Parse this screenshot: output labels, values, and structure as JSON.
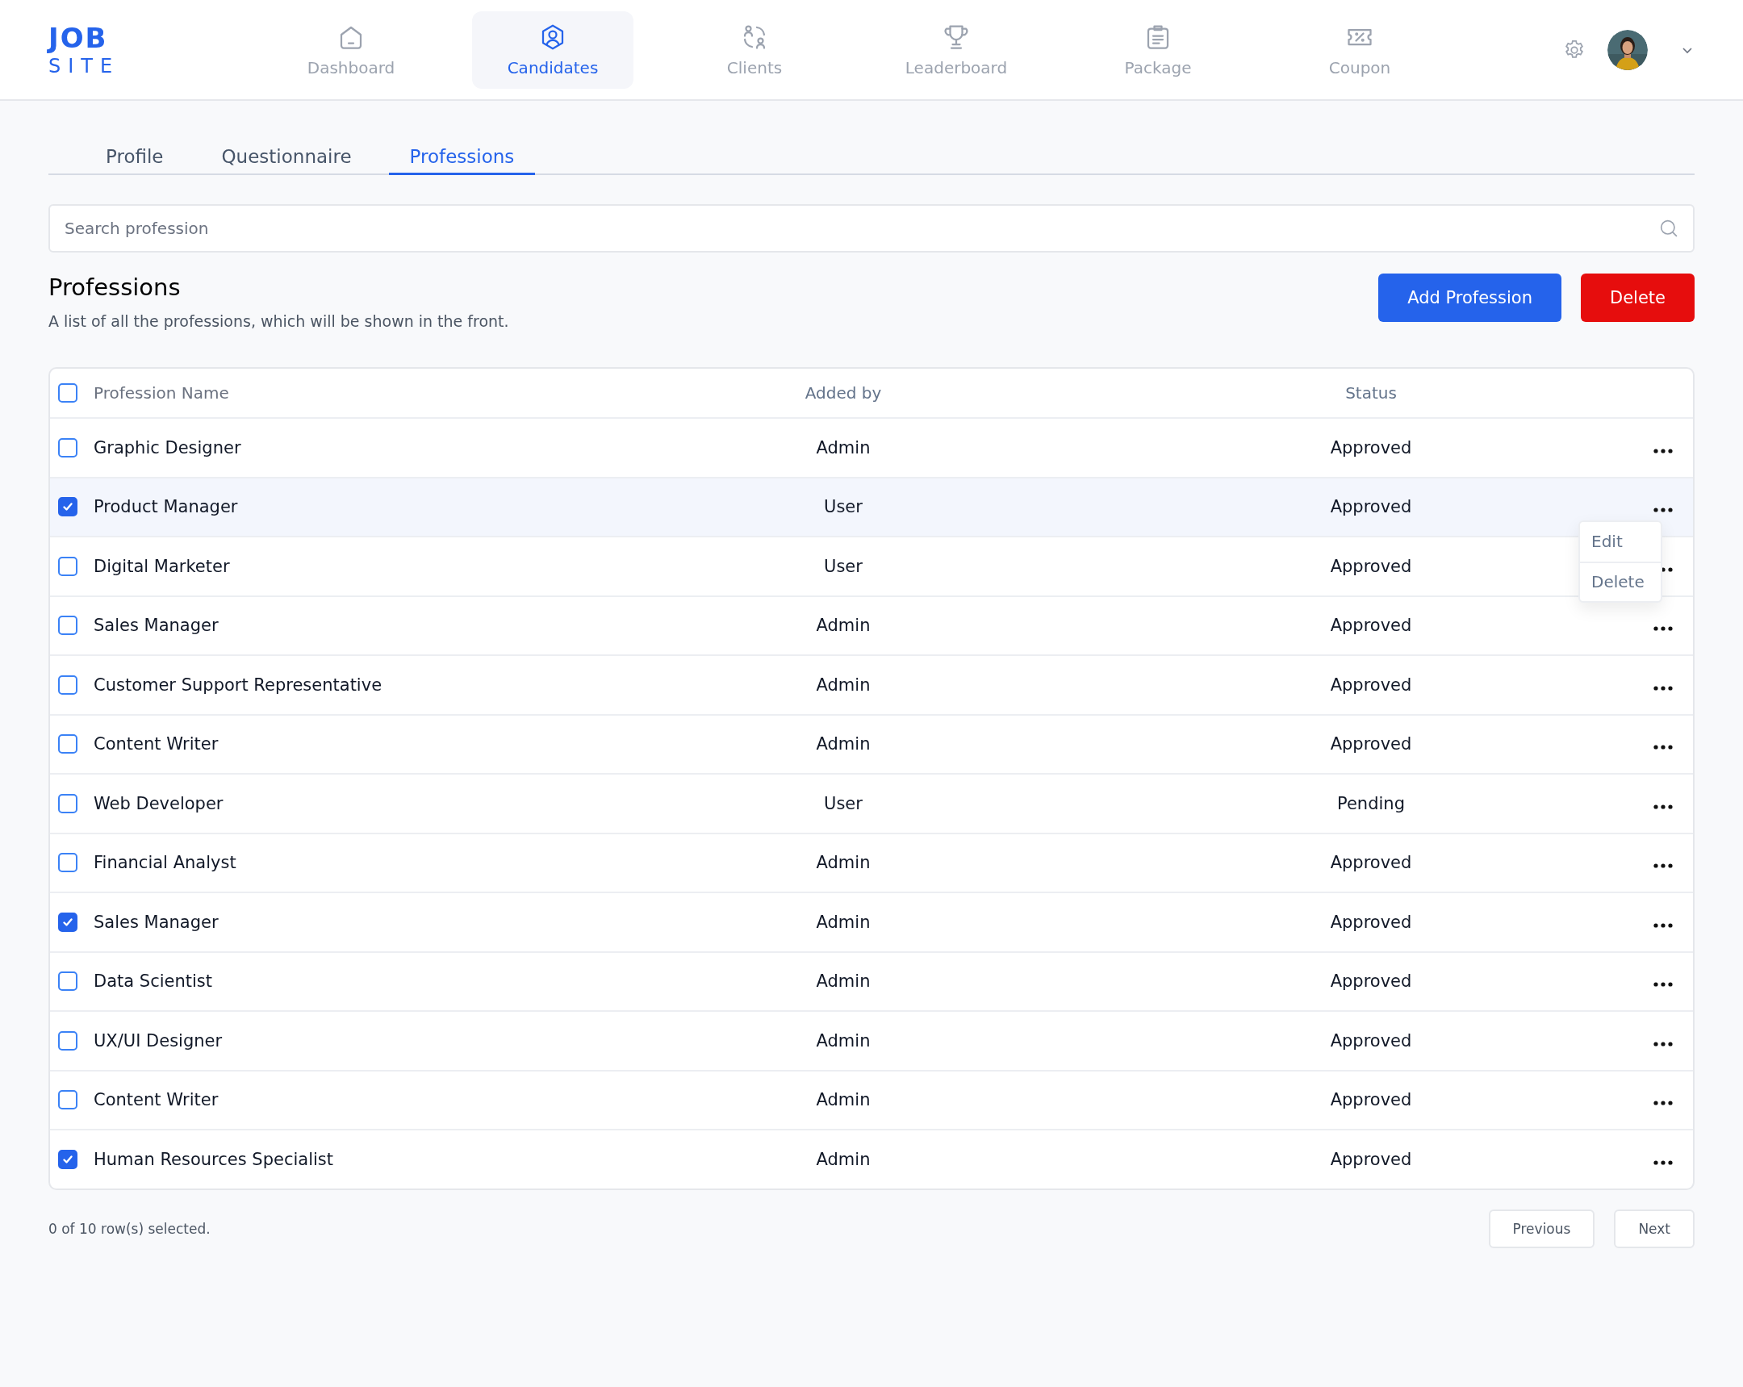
{
  "brand": {
    "line1": "JOB",
    "line2": "SITE"
  },
  "nav": [
    {
      "label": "Dashboard",
      "selected": false
    },
    {
      "label": "Candidates",
      "selected": true
    },
    {
      "label": "Clients",
      "selected": false
    },
    {
      "label": "Leaderboard",
      "selected": false
    },
    {
      "label": "Package",
      "selected": false
    },
    {
      "label": "Coupon",
      "selected": false
    }
  ],
  "subtabs": [
    {
      "label": "Profile",
      "selected": false
    },
    {
      "label": "Questionnaire",
      "selected": false
    },
    {
      "label": "Professions",
      "selected": true
    }
  ],
  "search": {
    "placeholder": "Search profession"
  },
  "section": {
    "title": "Professions",
    "description": "A list of all the professions, which will be shown in the front."
  },
  "actions": [
    {
      "label": "Add Profession",
      "kind": "primary"
    },
    {
      "label": "Delete",
      "kind": "danger"
    }
  ],
  "table": {
    "select_all_checked": false,
    "columns": [
      "Profession Name",
      "Added by",
      "Status"
    ],
    "row_menu": [
      "Edit",
      "Delete"
    ],
    "rows": [
      {
        "name": "Graphic Designer",
        "added_by": "Admin",
        "status": "Approved",
        "checked": false,
        "highlighted": false,
        "menu_open": false
      },
      {
        "name": "Product Manager",
        "added_by": "User",
        "status": "Approved",
        "checked": true,
        "highlighted": true,
        "menu_open": true
      },
      {
        "name": "Digital Marketer",
        "added_by": "User",
        "status": "Approved",
        "checked": false,
        "highlighted": false,
        "menu_open": false
      },
      {
        "name": "Sales Manager",
        "added_by": "Admin",
        "status": "Approved",
        "checked": false,
        "highlighted": false,
        "menu_open": false
      },
      {
        "name": "Customer Support Representative",
        "added_by": "Admin",
        "status": "Approved",
        "checked": false,
        "highlighted": false,
        "menu_open": false
      },
      {
        "name": "Content Writer",
        "added_by": "Admin",
        "status": "Approved",
        "checked": false,
        "highlighted": false,
        "menu_open": false
      },
      {
        "name": "Web Developer",
        "added_by": "User",
        "status": "Pending",
        "checked": false,
        "highlighted": false,
        "menu_open": false
      },
      {
        "name": "Financial Analyst",
        "added_by": "Admin",
        "status": "Approved",
        "checked": false,
        "highlighted": false,
        "menu_open": false
      },
      {
        "name": "Sales Manager",
        "added_by": "Admin",
        "status": "Approved",
        "checked": true,
        "highlighted": false,
        "menu_open": false
      },
      {
        "name": "Data Scientist",
        "added_by": "Admin",
        "status": "Approved",
        "checked": false,
        "highlighted": false,
        "menu_open": false
      },
      {
        "name": "UX/UI Designer",
        "added_by": "Admin",
        "status": "Approved",
        "checked": false,
        "highlighted": false,
        "menu_open": false
      },
      {
        "name": "Content Writer",
        "added_by": "Admin",
        "status": "Approved",
        "checked": false,
        "highlighted": false,
        "menu_open": false
      },
      {
        "name": "Human Resources Specialist",
        "added_by": "Admin",
        "status": "Approved",
        "checked": true,
        "highlighted": false,
        "menu_open": false
      }
    ]
  },
  "footer": {
    "selection": "0 of 10 row(s) selected.",
    "buttons": [
      "Previous",
      "Next"
    ]
  }
}
